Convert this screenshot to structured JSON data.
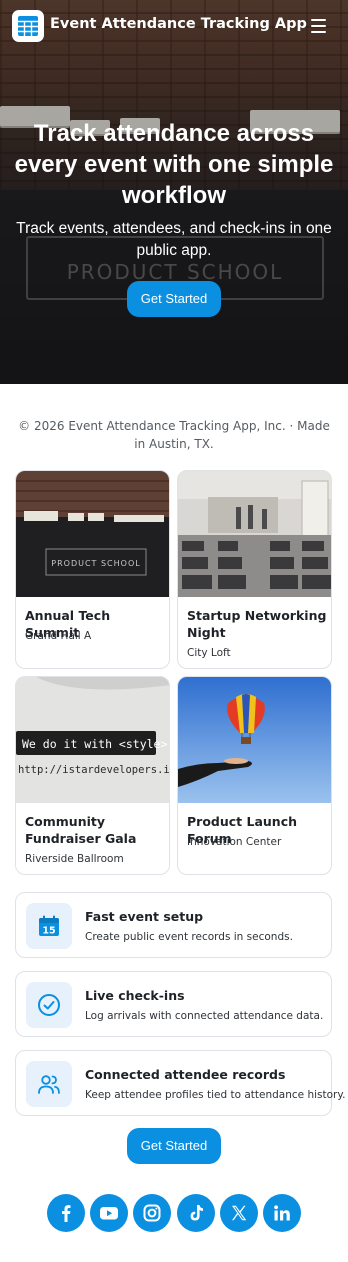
{
  "header": {
    "brand": "Event Attendance Tracking App",
    "logo_icon": "calendar-grid-icon",
    "menu_icon": "hamburger-menu-icon"
  },
  "hero": {
    "title": "Track attendance across every event with one simple workflow",
    "subtitle": "Track events, attendees, and check-ins in one public app.",
    "cta_label": "Get Started",
    "sign_text": "PRODUCT SCHOOL"
  },
  "footer_note": "© 2026 Event Attendance Tracking App, Inc. · Made in Austin, TX.",
  "events": [
    {
      "title": "Annual Tech Summit",
      "venue": "Grand Hall A",
      "sign_text": "PRODUCT SCHOOL"
    },
    {
      "title": "Startup Networking Night",
      "venue": "City Loft"
    },
    {
      "title": "Community Fundraiser Gala",
      "venue": "Riverside Ballroom",
      "shirt_line1": "We do it with <style>",
      "shirt_line2": "http://istardevelopers.in"
    },
    {
      "title": "Product Launch Forum",
      "venue": "Innovation Center"
    }
  ],
  "features": [
    {
      "title": "Fast event setup",
      "desc": "Create public event records in seconds.",
      "icon": "calendar-15-icon",
      "icon_text": "15"
    },
    {
      "title": "Live check-ins",
      "desc": "Log arrivals with connected attendance data.",
      "icon": "check-circle-icon"
    },
    {
      "title": "Connected attendee records",
      "desc": "Keep attendee profiles tied to attendance history.",
      "icon": "users-icon"
    }
  ],
  "bottom_cta_label": "Get Started",
  "social": [
    "facebook-icon",
    "youtube-icon",
    "instagram-icon",
    "tiktok-icon",
    "x-icon",
    "linkedin-icon"
  ],
  "colors": {
    "accent": "#0b8fe0",
    "accent_soft": "#e6f1fb",
    "border": "#dfe2e6"
  }
}
